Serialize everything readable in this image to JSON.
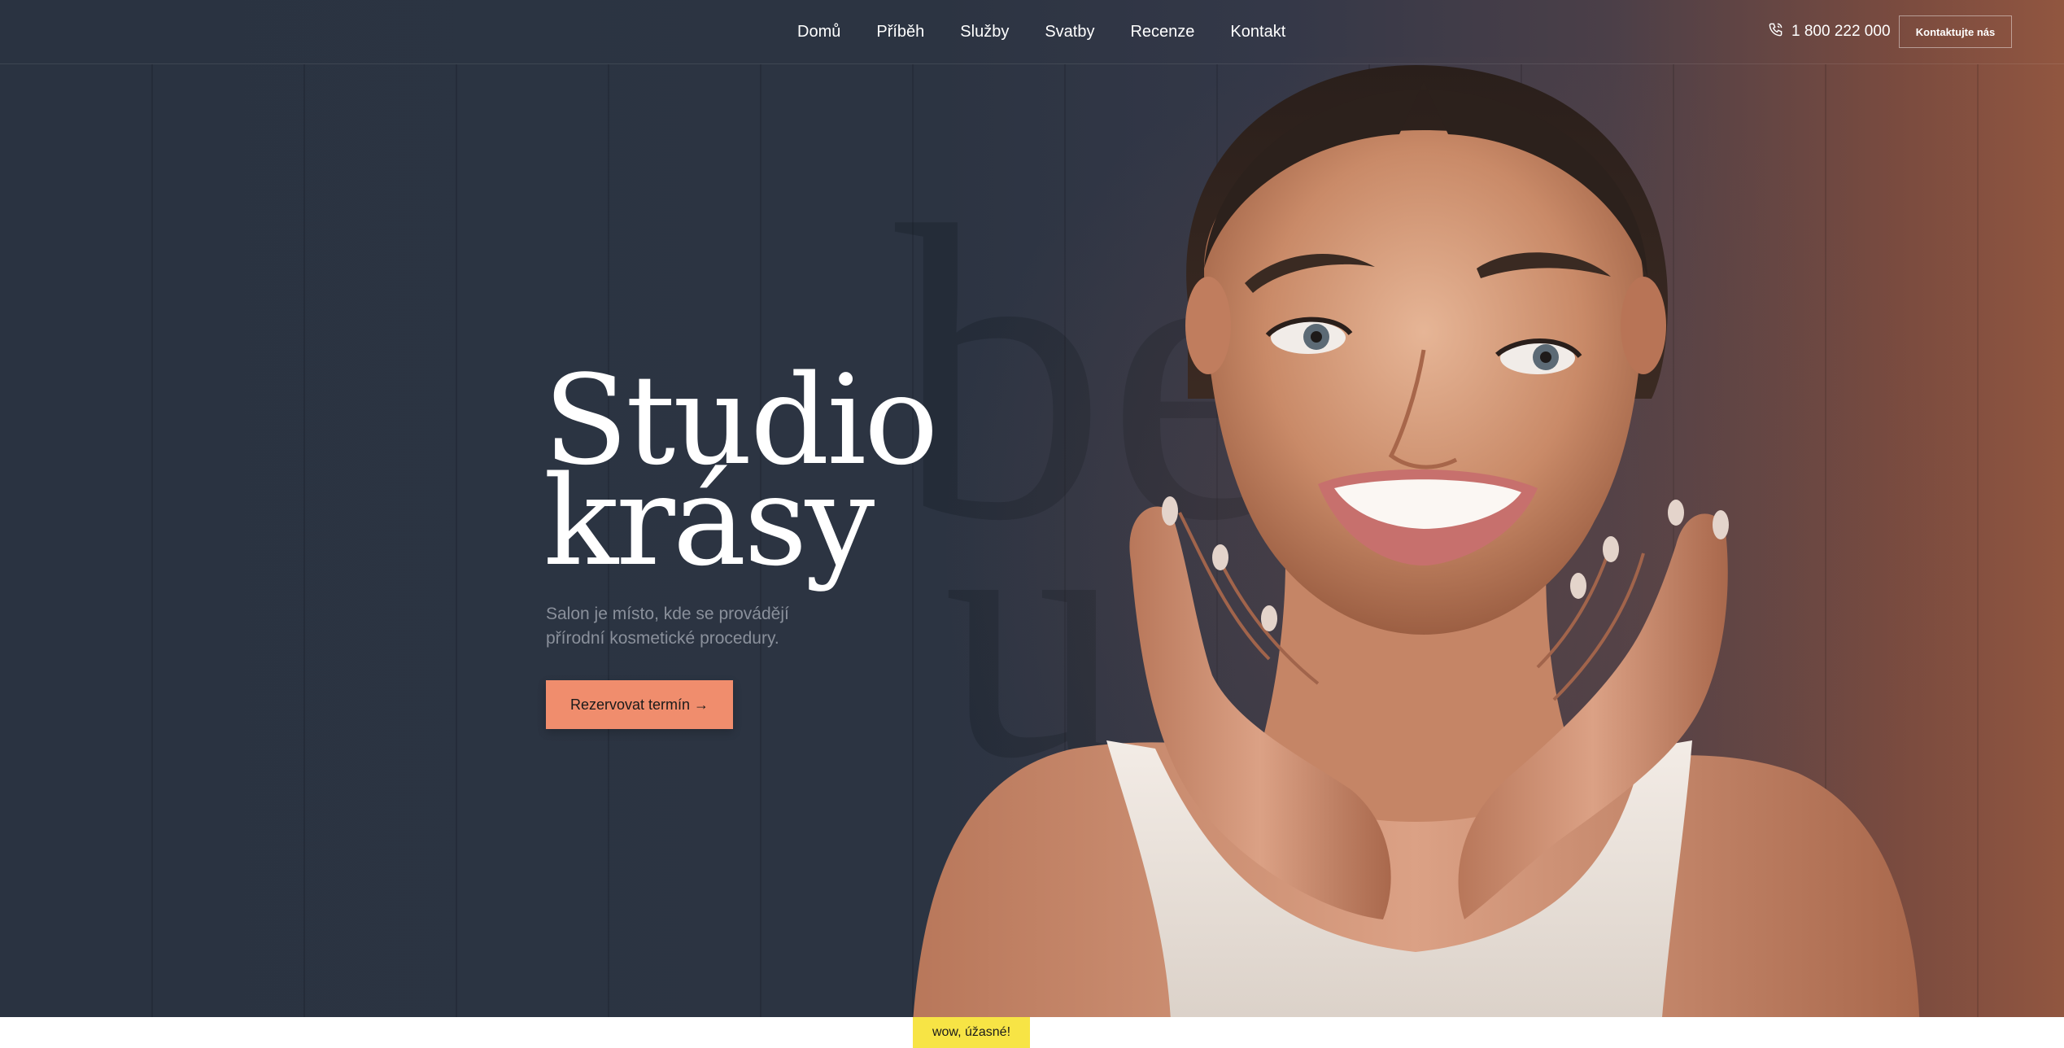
{
  "nav": {
    "items": [
      {
        "label": "Domů"
      },
      {
        "label": "Příběh"
      },
      {
        "label": "Služby"
      },
      {
        "label": "Svatby"
      },
      {
        "label": "Recenze"
      },
      {
        "label": "Kontakt"
      }
    ]
  },
  "header": {
    "phone_icon": "phone-icon",
    "phone": "1 800 222 000",
    "contact_button": "Kontaktujte nás"
  },
  "hero": {
    "title_line1": "Studio",
    "title_line2": "krásy",
    "subtitle": "Salon je místo, kde se provádějí přírodní kosmetické procedury.",
    "book_button": "Rezervovat termín →",
    "deco_text_1": "be",
    "deco_text_2": "u"
  },
  "badge": {
    "label": "wow, úžasné!"
  },
  "colors": {
    "background": "#2b3442",
    "accent": "#f08d6d",
    "badge": "#f7e445"
  }
}
